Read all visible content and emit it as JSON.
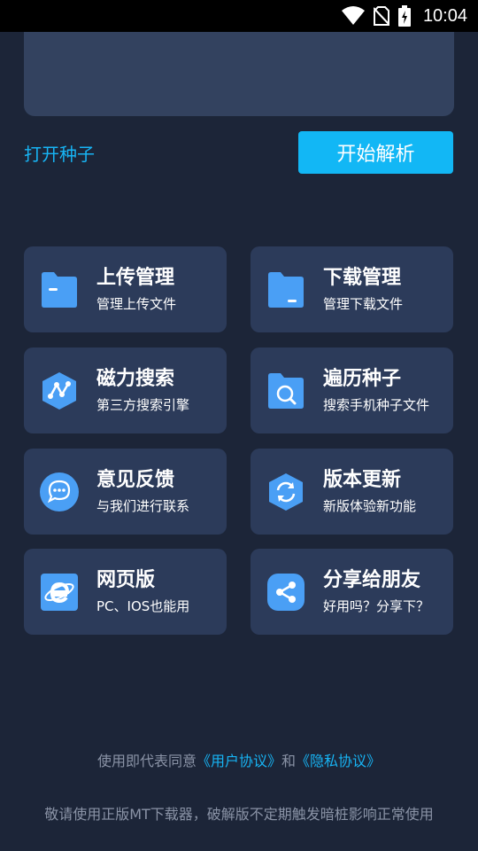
{
  "status_bar": {
    "time": "10:04",
    "icons": [
      "wifi-icon",
      "no-sim-icon",
      "battery-charging-icon"
    ]
  },
  "actions": {
    "open_torrent": "打开种子",
    "start_parse": "开始解析"
  },
  "cards": [
    {
      "title": "上传管理",
      "subtitle": "管理上传文件",
      "icon": "folder-icon"
    },
    {
      "title": "下载管理",
      "subtitle": "管理下载文件",
      "icon": "folder-icon"
    },
    {
      "title": "磁力搜索",
      "subtitle": "第三方搜索引擎",
      "icon": "share-nodes-hexagon-icon"
    },
    {
      "title": "遍历种子",
      "subtitle": "搜索手机种子文件",
      "icon": "folder-search-icon"
    },
    {
      "title": "意见反馈",
      "subtitle": "与我们进行联系",
      "icon": "chat-bubble-icon"
    },
    {
      "title": "版本更新",
      "subtitle": "新版体验新功能",
      "icon": "refresh-hexagon-icon"
    },
    {
      "title": "网页版",
      "subtitle": "PC、IOS也能用",
      "icon": "browser-e-icon"
    },
    {
      "title": "分享给朋友",
      "subtitle": "好用吗？分享下？",
      "icon": "share-icon"
    }
  ],
  "footer": {
    "agree_prefix": "使用即代表同意",
    "user_agreement": "《用户协议》",
    "and": "和",
    "privacy_agreement": "《隐私协议》",
    "warning": "敬请使用正版MT下载器，破解版不定期触发暗桩影响正常使用"
  },
  "colors": {
    "background": "#1c2538",
    "card": "#2c3b5a",
    "accent": "#12b7f5",
    "icon_blue": "#4a9ff5"
  }
}
